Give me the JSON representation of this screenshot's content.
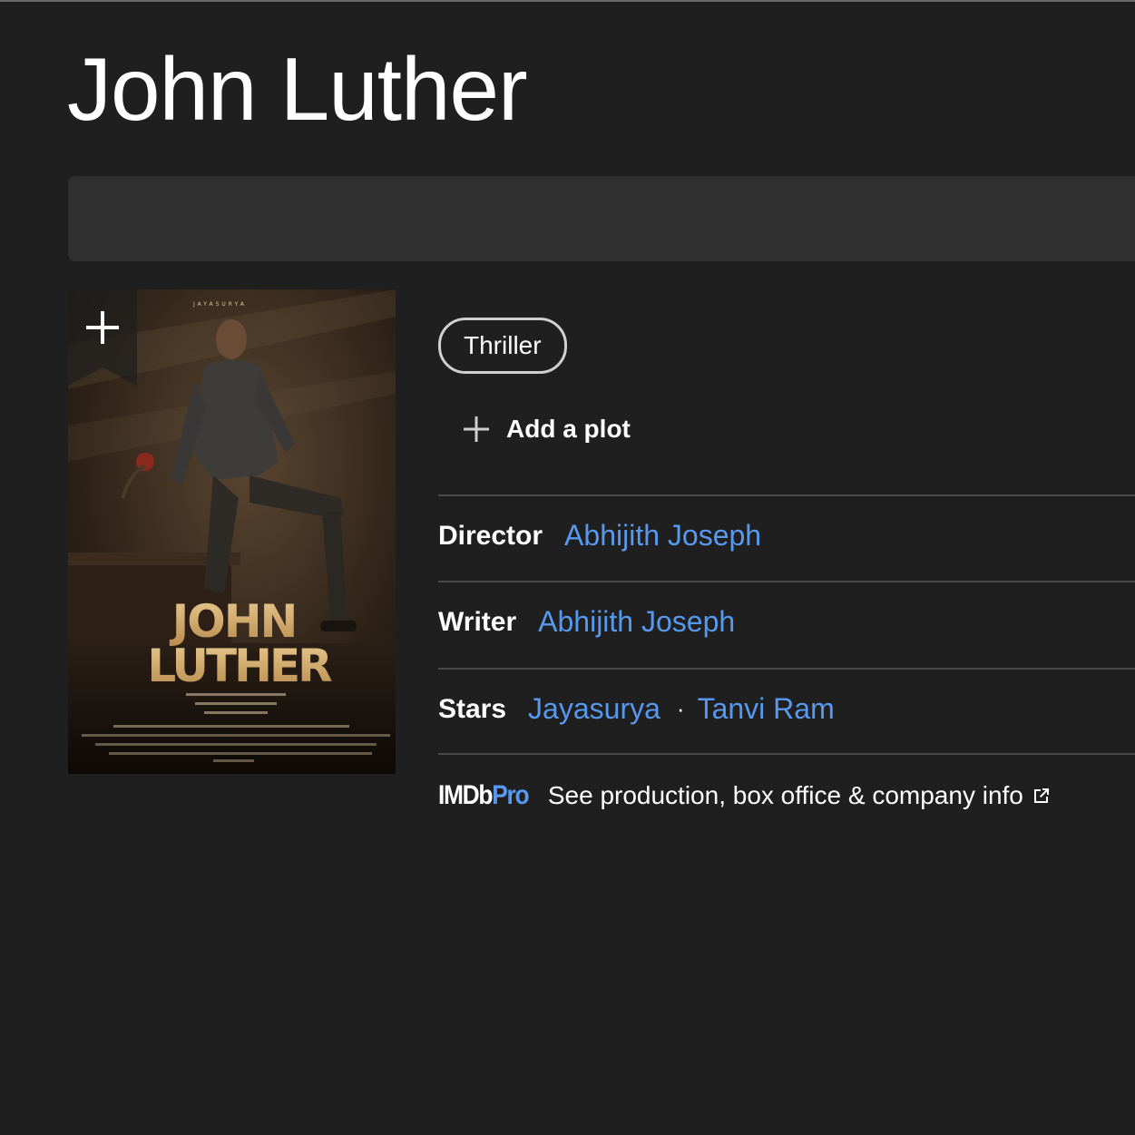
{
  "title": "John Luther",
  "poster": {
    "top_credit": "JAYASURYA",
    "title_line1": "JOHN",
    "title_line2": "LUTHER",
    "watchlist_icon": "plus-icon"
  },
  "genres": [
    "Thriller"
  ],
  "add_plot": {
    "icon": "plus-icon",
    "label": "Add a plot"
  },
  "credits": {
    "director": {
      "label": "Director",
      "names": [
        "Abhijith Joseph"
      ]
    },
    "writer": {
      "label": "Writer",
      "names": [
        "Abhijith Joseph"
      ]
    },
    "stars": {
      "label": "Stars",
      "names": [
        "Jayasurya",
        "Tanvi Ram"
      ],
      "separator": "·"
    }
  },
  "imdbpro": {
    "logo_imdb": "IMDb",
    "logo_pro": "Pro",
    "text": "See production, box office & company info",
    "icon": "external-link-icon"
  },
  "colors": {
    "background": "#1f1f1f",
    "link": "#5799ef",
    "strip": "#2f2f2f",
    "divider": "#4a4a4a"
  }
}
